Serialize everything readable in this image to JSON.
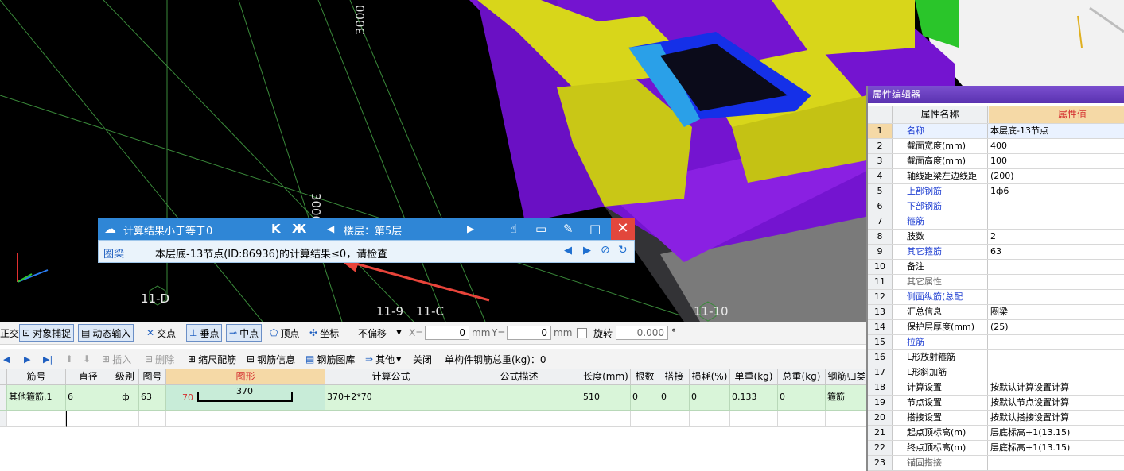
{
  "viewport": {
    "axis_labels": [
      "11-D",
      "11-9",
      "11-C",
      "11-10"
    ],
    "dim_labels": [
      "3000",
      "3000"
    ]
  },
  "calc_panel": {
    "title": "计算结果小于等于0",
    "floor_label": "楼层：第5层",
    "category": "圈梁",
    "message": "本层底-13节点(ID:86936)的计算结果≤0，请检查"
  },
  "toolbar1": {
    "ortho": "正交",
    "snap": "对象捕捉",
    "dynamic_input": "动态输入",
    "intersect": "交点",
    "perpendicular": "垂点",
    "midpoint": "中点",
    "vertex": "顶点",
    "coordinate": "坐标",
    "offset_mode": "不偏移",
    "x_label": "X=",
    "x_value": "0",
    "x_unit": "mm",
    "y_label": "Y=",
    "y_value": "0",
    "y_unit": "mm",
    "rotate_label": "旋转",
    "rotate_value": "0.000",
    "degree": "°"
  },
  "toolbar2": {
    "insert": "插入",
    "delete": "删除",
    "scale_rebar": "缩尺配筋",
    "rebar_info": "钢筋信息",
    "rebar_library": "钢筋图库",
    "other": "其他",
    "close": "关闭",
    "total_weight_label": "单构件钢筋总重(kg)：0"
  },
  "grid": {
    "headers": [
      "筋号",
      "直径(mm)",
      "级别",
      "图号",
      "图形",
      "计算公式",
      "公式描述",
      "长度(mm)",
      "根数",
      "搭接",
      "损耗(%)",
      "单重(kg)",
      "总重(kg)",
      "钢筋归类"
    ],
    "row": {
      "name": "其他箍筋.1",
      "diameter": "6",
      "grade": "ф",
      "shape_no": "63",
      "shape_left": "70",
      "shape_mid": "370",
      "formula": "370+2*70",
      "desc": "",
      "length": "510",
      "count": "0",
      "lap": "0",
      "loss": "0",
      "unit_weight": "0.133",
      "total_weight": "0",
      "category": "箍筋"
    }
  },
  "prop_editor": {
    "title": "属性编辑器",
    "col_name": "属性名称",
    "col_value": "属性值",
    "rows": [
      {
        "n": "1",
        "name": "名称",
        "value": "本层底-13节点"
      },
      {
        "n": "2",
        "name": "截面宽度(mm)",
        "value": "400"
      },
      {
        "n": "3",
        "name": "截面高度(mm)",
        "value": "100"
      },
      {
        "n": "4",
        "name": "轴线距梁左边线距",
        "value": "(200)"
      },
      {
        "n": "5",
        "name": "上部钢筋",
        "value": "1ф6"
      },
      {
        "n": "6",
        "name": "下部钢筋",
        "value": ""
      },
      {
        "n": "7",
        "name": "箍筋",
        "value": ""
      },
      {
        "n": "8",
        "name": "肢数",
        "value": "2"
      },
      {
        "n": "9",
        "name": "其它箍筋",
        "value": "63"
      },
      {
        "n": "10",
        "name": "备注",
        "value": ""
      },
      {
        "n": "11",
        "name": "其它属性",
        "value": ""
      },
      {
        "n": "12",
        "name": "侧面纵筋(总配",
        "value": ""
      },
      {
        "n": "13",
        "name": "汇总信息",
        "value": "圈梁"
      },
      {
        "n": "14",
        "name": "保护层厚度(mm)",
        "value": "(25)"
      },
      {
        "n": "15",
        "name": "拉筋",
        "value": ""
      },
      {
        "n": "16",
        "name": "L形放射箍筋",
        "value": ""
      },
      {
        "n": "17",
        "name": "L形斜加筋",
        "value": ""
      },
      {
        "n": "18",
        "name": "计算设置",
        "value": "按默认计算设置计算"
      },
      {
        "n": "19",
        "name": "节点设置",
        "value": "按默认节点设置计算"
      },
      {
        "n": "20",
        "name": "搭接设置",
        "value": "按默认搭接设置计算"
      },
      {
        "n": "21",
        "name": "起点顶标高(m)",
        "value": "层底标高+1(13.15)"
      },
      {
        "n": "22",
        "name": "终点顶标高(m)",
        "value": "层底标高+1(13.15)"
      },
      {
        "n": "23",
        "name": "锚固搭接",
        "value": ""
      }
    ]
  },
  "colors": {
    "viewport_bg": "#000000",
    "panel_blue": "#2f86d6",
    "purple": "#7a16d6",
    "yellow": "#d8d61a",
    "row_green": "#d9f5d9",
    "arrow_red": "#e8443a"
  }
}
